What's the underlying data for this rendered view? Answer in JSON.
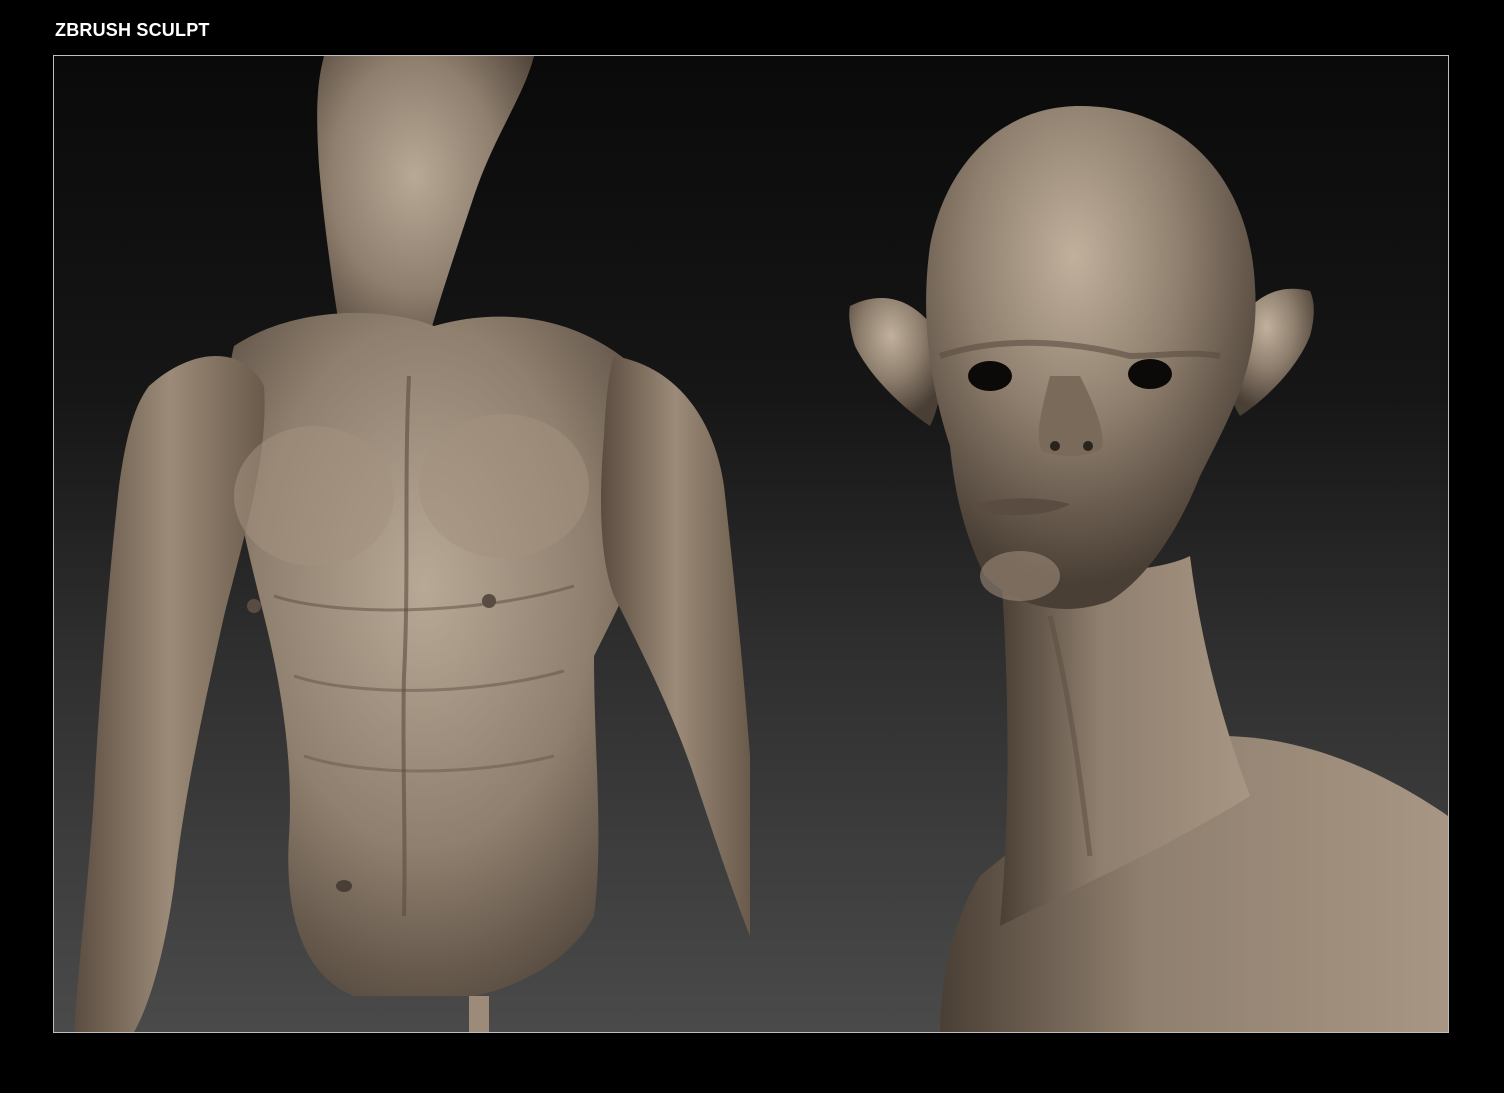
{
  "header": {
    "title": "ZBRUSH SCULPT"
  },
  "colors": {
    "page_background": "#000000",
    "frame_border": "#bfbfbf",
    "sculpt_clay": "#8f7f6e",
    "sculpt_highlight": "#b8a896",
    "sculpt_shadow": "#4a3f35",
    "viewport_gradient_top": "#0a0a0a",
    "viewport_gradient_bottom": "#4a4a4a"
  },
  "panels": [
    {
      "subject": "torso-front-view"
    },
    {
      "subject": "head-bust-three-quarter-view"
    }
  ]
}
